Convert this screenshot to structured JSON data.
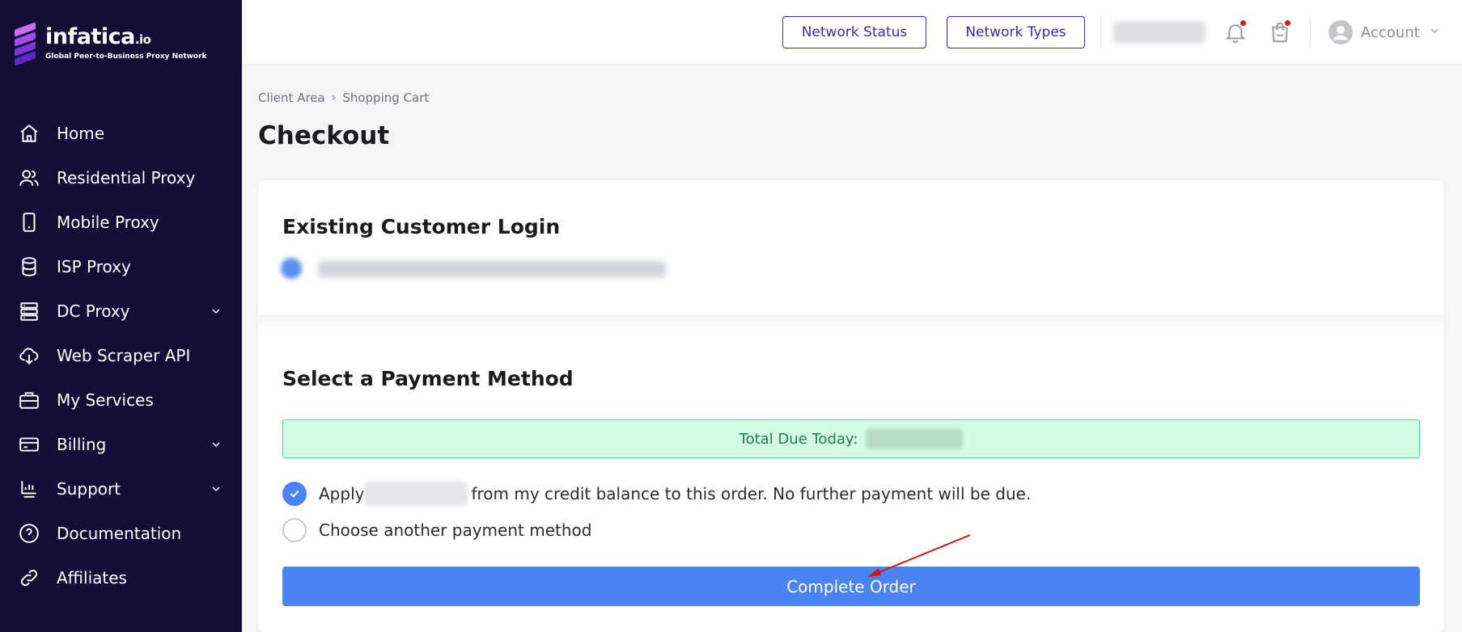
{
  "brand": {
    "name": "infatica",
    "suffix": ".io",
    "tagline": "Global Peer-to-Business Proxy Network",
    "colors": [
      "#c86bf2",
      "#a24ee6",
      "#7a35d6",
      "#5b28c2"
    ]
  },
  "sidebar": {
    "background": "#130e37",
    "items": [
      {
        "label": "Home",
        "icon": "home-icon",
        "has_submenu": false
      },
      {
        "label": "Residential Proxy",
        "icon": "users-icon",
        "has_submenu": false
      },
      {
        "label": "Mobile Proxy",
        "icon": "smartphone-icon",
        "has_submenu": false
      },
      {
        "label": "ISP Proxy",
        "icon": "database-icon",
        "has_submenu": false
      },
      {
        "label": "DC Proxy",
        "icon": "server-icon",
        "has_submenu": true
      },
      {
        "label": "Web Scraper API",
        "icon": "cloud-download-icon",
        "has_submenu": false
      },
      {
        "label": "My Services",
        "icon": "briefcase-icon",
        "has_submenu": false
      },
      {
        "label": "Billing",
        "icon": "credit-card-icon",
        "has_submenu": true
      },
      {
        "label": "Support",
        "icon": "chart-screen-icon",
        "has_submenu": true
      },
      {
        "label": "Documentation",
        "icon": "help-circle-icon",
        "has_submenu": false
      },
      {
        "label": "Affiliates",
        "icon": "link-icon",
        "has_submenu": false
      }
    ]
  },
  "topbar": {
    "network_status_label": "Network Status",
    "network_types_label": "Network Types",
    "account_label": "Account",
    "notification_icon": "bell-icon",
    "cart_icon": "shopping-bag-icon"
  },
  "breadcrumb": {
    "items": [
      "Client Area",
      "Shopping Cart"
    ]
  },
  "page": {
    "title": "Checkout"
  },
  "login_section": {
    "title": "Existing Customer Login"
  },
  "payment": {
    "title": "Select a Payment Method",
    "total_label": "Total Due Today:",
    "option_credit_prefix": "Apply",
    "option_credit_suffix": "from my credit balance to this order. No further payment will be due.",
    "option_credit_checked": true,
    "option_other_label": "Choose another payment method",
    "option_other_checked": false,
    "complete_label": "Complete Order"
  },
  "colors": {
    "accent": "#4a83f2",
    "outline_button": "#3b2fa0",
    "success_bg": "#d1fbe4",
    "notification_dot": "#e3141c"
  }
}
